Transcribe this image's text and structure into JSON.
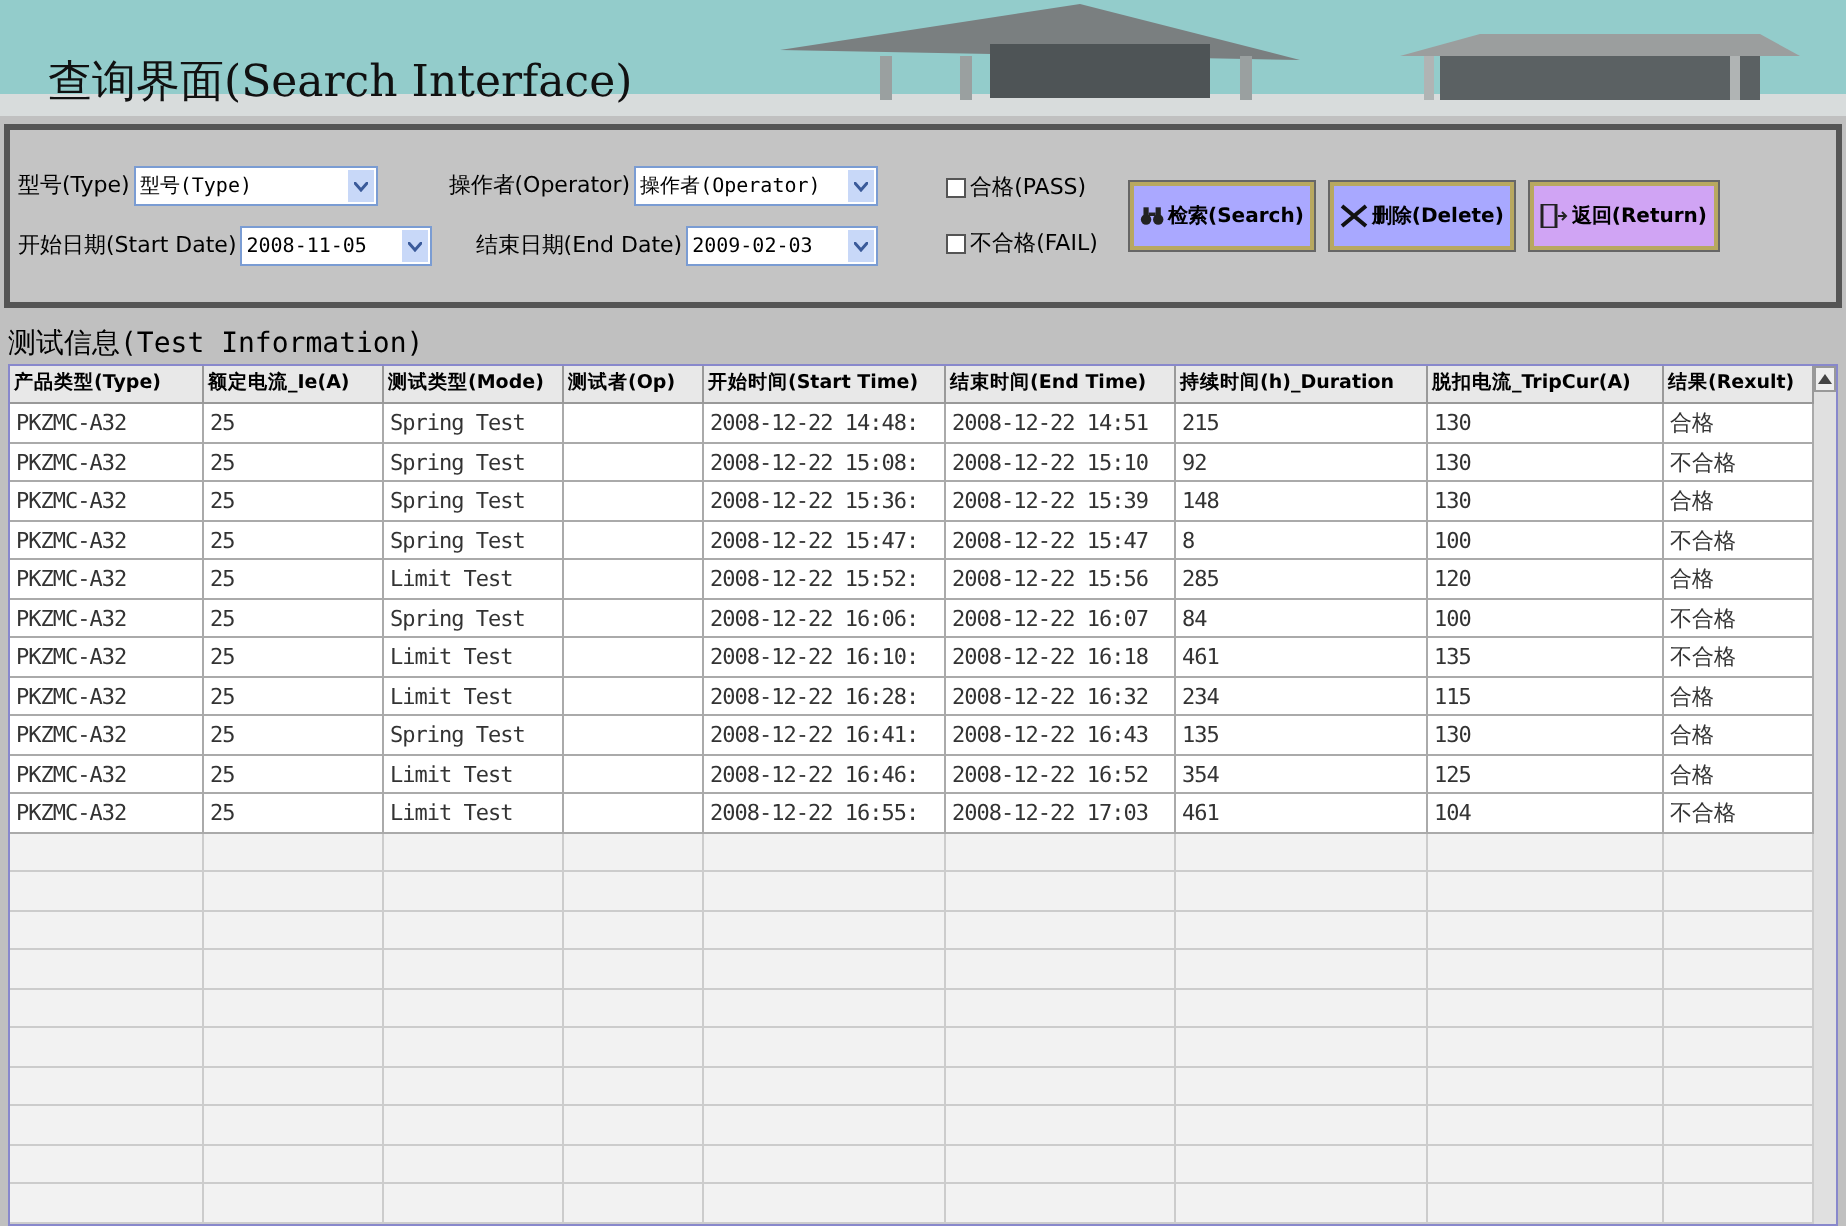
{
  "window": {
    "title": "查询界面(Search Interface)"
  },
  "filters": [
    {
      "label": "型号(Type)",
      "value": "型号(Type)"
    },
    {
      "label": "操作者(Operator)",
      "value": "操作者(Operator)"
    },
    {
      "label": "开始日期(Start Date)",
      "value": "2008-11-05"
    },
    {
      "label": "结束日期(End Date)",
      "value": "2009-02-03"
    }
  ],
  "checkboxes": [
    {
      "label": "合格(PASS)",
      "checked": false
    },
    {
      "label": "不合格(FAIL)",
      "checked": false
    }
  ],
  "buttons": [
    {
      "kind": "search",
      "label": "检索(Search)"
    },
    {
      "kind": "delete",
      "label": "删除(Delete)"
    },
    {
      "kind": "return",
      "label": "返回(Return)"
    }
  ],
  "section_title": "测试信息(Test Information)",
  "table": {
    "columns": [
      "产品类型(Type)",
      "额定电流_Ie(A)",
      "测试类型(Mode)",
      "测试者(Op)",
      "开始时间(Start Time)",
      "结束时间(End Time)",
      "持续时间(h)_Duration",
      "脱扣电流_TripCur(A)",
      "结果(Rexult)"
    ],
    "rows": [
      [
        "PKZMC-A32",
        "25",
        "Spring Test",
        "",
        "2008-12-22 14:48:",
        "2008-12-22 14:51",
        "215",
        "130",
        "合格"
      ],
      [
        "PKZMC-A32",
        "25",
        "Spring Test",
        "",
        "2008-12-22 15:08:",
        "2008-12-22 15:10",
        "92",
        "130",
        "不合格"
      ],
      [
        "PKZMC-A32",
        "25",
        "Spring Test",
        "",
        "2008-12-22 15:36:",
        "2008-12-22 15:39",
        "148",
        "130",
        "合格"
      ],
      [
        "PKZMC-A32",
        "25",
        "Spring Test",
        "",
        "2008-12-22 15:47:",
        "2008-12-22 15:47",
        "8",
        "100",
        "不合格"
      ],
      [
        "PKZMC-A32",
        "25",
        "Limit Test",
        "",
        "2008-12-22 15:52:",
        "2008-12-22 15:56",
        "285",
        "120",
        "合格"
      ],
      [
        "PKZMC-A32",
        "25",
        "Spring Test",
        "",
        "2008-12-22 16:06:",
        "2008-12-22 16:07",
        "84",
        "100",
        "不合格"
      ],
      [
        "PKZMC-A32",
        "25",
        "Limit Test",
        "",
        "2008-12-22 16:10:",
        "2008-12-22 16:18",
        "461",
        "135",
        "不合格"
      ],
      [
        "PKZMC-A32",
        "25",
        "Limit Test",
        "",
        "2008-12-22 16:28:",
        "2008-12-22 16:32",
        "234",
        "115",
        "合格"
      ],
      [
        "PKZMC-A32",
        "25",
        "Spring Test",
        "",
        "2008-12-22 16:41:",
        "2008-12-22 16:43",
        "135",
        "130",
        "合格"
      ],
      [
        "PKZMC-A32",
        "25",
        "Limit Test",
        "",
        "2008-12-22 16:46:",
        "2008-12-22 16:52",
        "354",
        "125",
        "合格"
      ],
      [
        "PKZMC-A32",
        "25",
        "Limit Test",
        "",
        "2008-12-22 16:55:",
        "2008-12-22 17:03",
        "461",
        "104",
        "不合格"
      ]
    ]
  }
}
